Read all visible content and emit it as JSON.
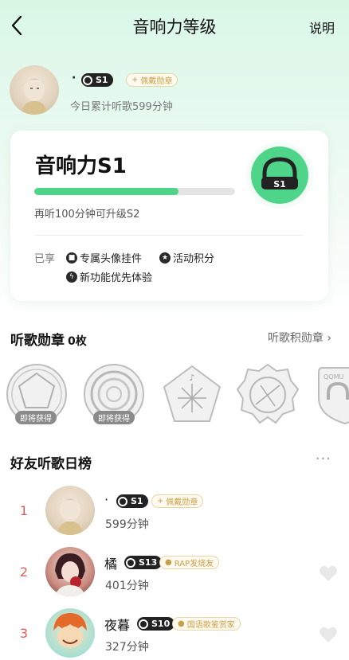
{
  "header": {
    "title": "音响力等级",
    "help": "说明"
  },
  "user": {
    "name": "·",
    "level": "S1",
    "medal_tag": "佩戴勋章",
    "today": "今日累计听歌599分钟"
  },
  "level_card": {
    "title": "音响力S1",
    "progress": 0.72,
    "hint": "再听100分钟可升级S2",
    "emblem_label": "S1",
    "perks_label": "已享",
    "perks": [
      "专属头像挂件",
      "活动积分",
      "新功能优先体验"
    ]
  },
  "medals_section": {
    "title": "听歌勋章",
    "count": "0枚",
    "link": "听歌积勋章 ›",
    "soon": "即将获得",
    "partial_logo": "QQMU"
  },
  "friends_section": {
    "title": "好友听歌日榜",
    "more": "···",
    "rows": [
      {
        "rank": "1",
        "name": "·",
        "level": "S1",
        "tag": "佩戴勋章",
        "time": "599分钟"
      },
      {
        "rank": "2",
        "name": "橘",
        "level": "S13",
        "tag": "RAP发烧友",
        "time": "401分钟"
      },
      {
        "rank": "3",
        "name": "夜暮",
        "level": "S10",
        "tag": "国语歌鉴赏家",
        "time": "327分钟"
      }
    ]
  },
  "colors": {
    "accent": "#4fd58a",
    "rank": "#e55a5a",
    "tag_gold": "#c7a04a"
  },
  "icons": [
    "back-arrow-icon",
    "headphone-icon",
    "chevron-right-icon",
    "heart-icon",
    "pendant-icon",
    "star-icon",
    "bolt-icon"
  ]
}
